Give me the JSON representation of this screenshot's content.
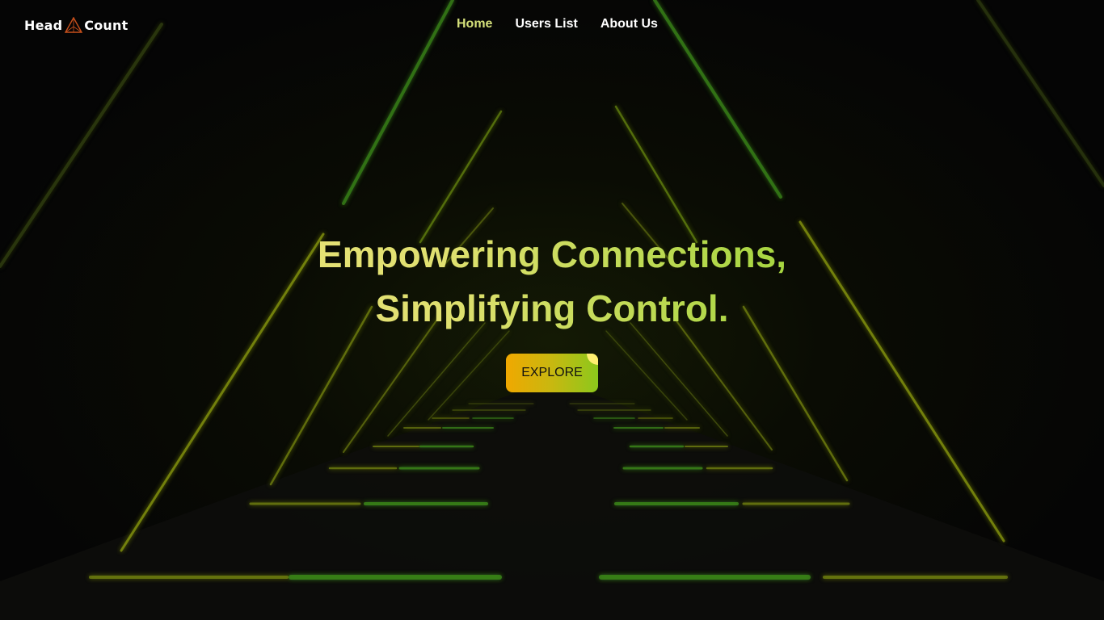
{
  "brand": {
    "name_left": "Head",
    "name_right": "Count",
    "logo_icon": "triangle-icon",
    "accent_color": "#d4e07a"
  },
  "nav": {
    "items": [
      {
        "label": "Home",
        "active": true
      },
      {
        "label": "Users List",
        "active": false
      },
      {
        "label": "About Us",
        "active": false
      }
    ]
  },
  "hero": {
    "line1": "Empowering Connections,",
    "line2": "Simplifying Control.",
    "cta_label": "EXPLORE"
  },
  "colors": {
    "background": "#050505",
    "neon_yellow": "#c8c820",
    "neon_green": "#4caf20",
    "gradient_start": "#f0a800",
    "gradient_end": "#8cc81c"
  }
}
